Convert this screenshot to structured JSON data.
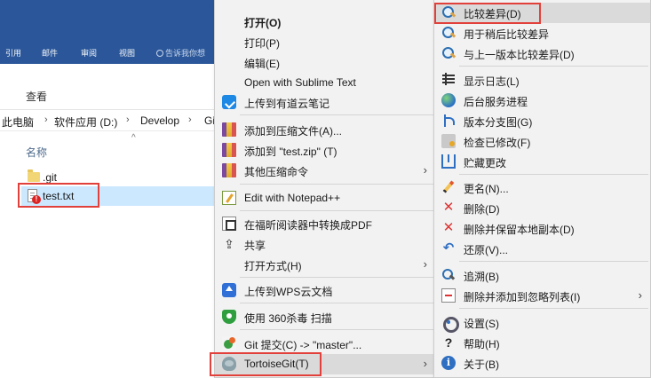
{
  "explorer": {
    "ribbon_tabs": [
      "引用",
      "邮件",
      "审阅",
      "视图"
    ],
    "search_hint": "告诉我你想",
    "view_label": "查看",
    "breadcrumb": [
      "此电脑",
      "软件应用 (D:)",
      "Develop",
      "Gi"
    ],
    "column_name": "名称",
    "files": [
      {
        "name": ".git",
        "type": "folder"
      },
      {
        "name": "test.txt",
        "type": "text",
        "status": "conflict"
      }
    ]
  },
  "context_menu": {
    "items": [
      {
        "label": "打开(O)"
      },
      {
        "label": "打印(P)"
      },
      {
        "label": "编辑(E)"
      },
      {
        "label": "Open with Sublime Text"
      },
      {
        "label": "上传到有道云笔记"
      },
      {
        "label": "添加到压缩文件(A)..."
      },
      {
        "label": "添加到 \"test.zip\" (T)"
      },
      {
        "label": "其他压缩命令"
      },
      {
        "label": "Edit with Notepad++"
      },
      {
        "label": "在福昕阅读器中转换成PDF"
      },
      {
        "label": "共享"
      },
      {
        "label": "打开方式(H)"
      },
      {
        "label": "上传到WPS云文档"
      },
      {
        "label": "使用 360杀毒 扫描"
      },
      {
        "label": "Git 提交(C) -> \"master\"..."
      },
      {
        "label": "TortoiseGit(T)"
      }
    ],
    "submenu_arrow": "›"
  },
  "tortoisegit_submenu": {
    "items": [
      {
        "label": "比较差异(D)"
      },
      {
        "label": "用于稍后比较差异"
      },
      {
        "label": "与上一版本比较差异(D)"
      },
      {
        "label": "显示日志(L)"
      },
      {
        "label": "后台服务进程"
      },
      {
        "label": "版本分支图(G)"
      },
      {
        "label": "检查已修改(F)"
      },
      {
        "label": "贮藏更改"
      },
      {
        "label": "更名(N)..."
      },
      {
        "label": "删除(D)"
      },
      {
        "label": "删除并保留本地副本(D)"
      },
      {
        "label": "还原(V)..."
      },
      {
        "label": "追溯(B)"
      },
      {
        "label": "删除并添加到忽略列表(I)"
      },
      {
        "label": "设置(S)"
      },
      {
        "label": "帮助(H)"
      },
      {
        "label": "关于(B)"
      }
    ]
  },
  "icons": {
    "share_glyph": "⇪",
    "delete_glyph": "✕",
    "revert_glyph": "↶",
    "help_glyph": "?",
    "about_glyph": "i"
  },
  "colors": {
    "ribbon": "#2b579a",
    "selection": "#cce8ff",
    "highlight_box": "#e2403a",
    "menu_bg": "#f2f2f2"
  }
}
